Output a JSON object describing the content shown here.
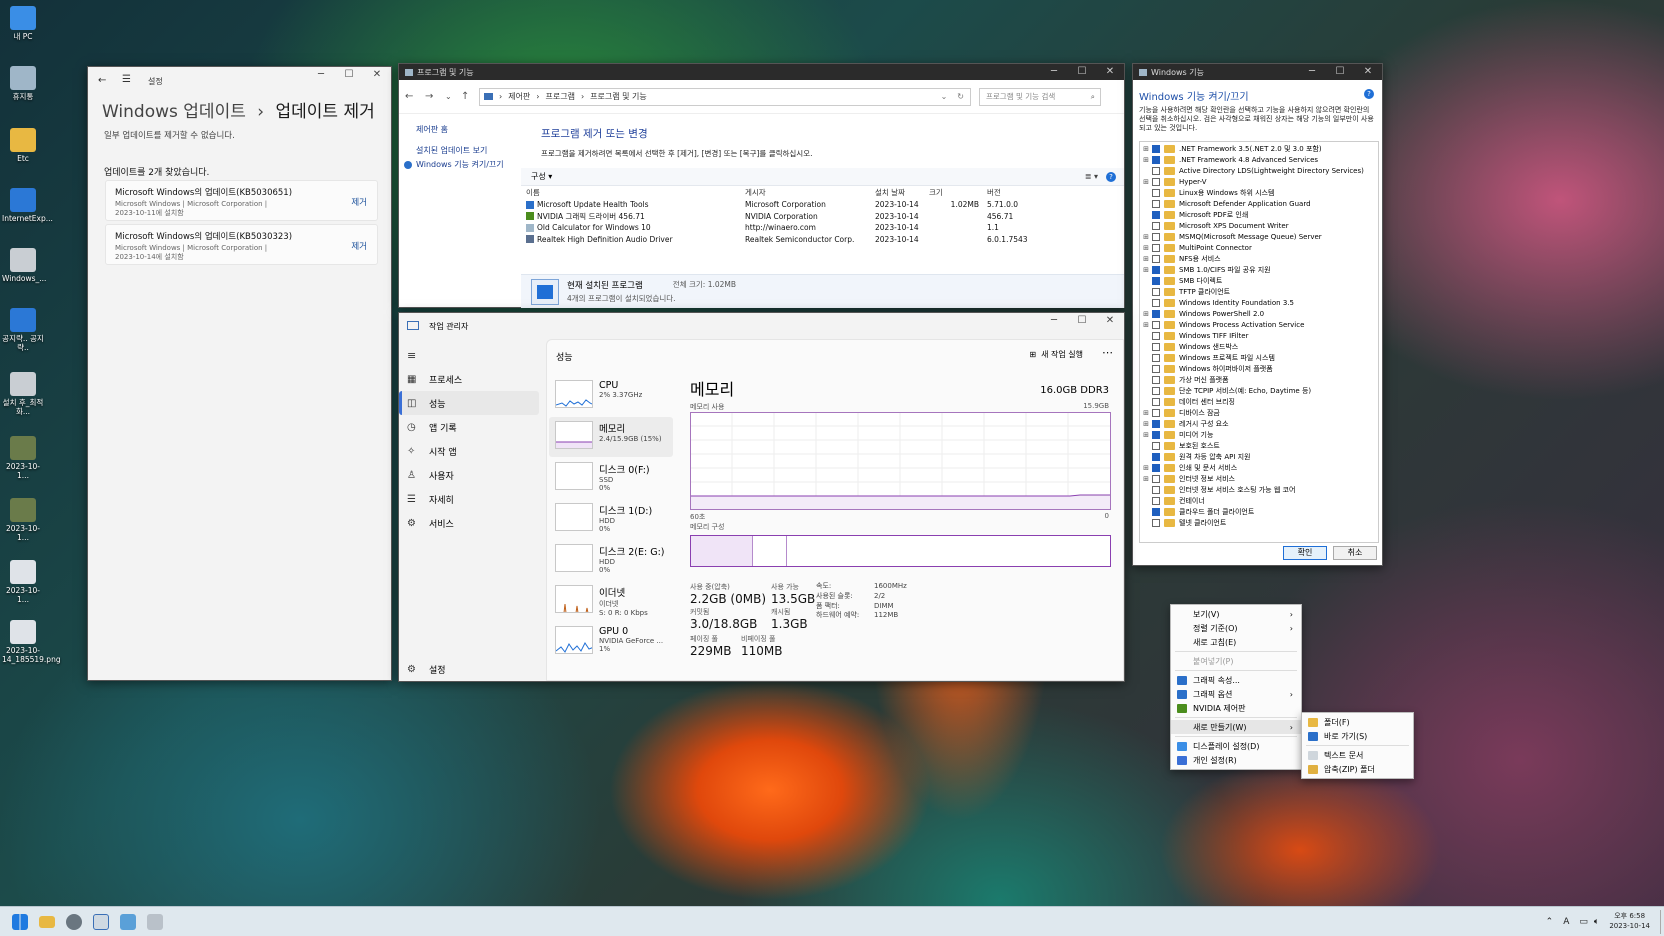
{
  "desktop_icons": [
    {
      "label": "내 PC",
      "color": "#3a8ee6"
    },
    {
      "label": "휴지통",
      "color": "#9fb6c8"
    },
    {
      "label": "Etc",
      "color": "#e8b842"
    },
    {
      "label": "InternetExp...",
      "color": "#2b78d6"
    },
    {
      "label": "Windows_...",
      "color": "#c9ced3"
    },
    {
      "label": "공지략.. 공지략..",
      "color": "#2b78d6"
    },
    {
      "label": "설치 후_최적화...",
      "color": "#c9ced3"
    },
    {
      "label": "2023-10-1...",
      "color": "#6a7b4a"
    },
    {
      "label": "2023-10-1...",
      "color": "#6a7b4a"
    },
    {
      "label": "2023-10-1...",
      "color": "#dfe3e8"
    },
    {
      "label": "2023-10-14_185519.png",
      "color": "#dfe3e8"
    }
  ],
  "settings": {
    "app_title": "설정",
    "breadcrumb_parent": "Windows 업데이트",
    "breadcrumb_sep": "›",
    "page_title": "업데이트 제거",
    "note": "일부 업데이트를 제거할 수 없습니다.",
    "found": "업데이트를 2개 찾았습니다.",
    "updates": [
      {
        "name": "Microsoft Windows의 업데이트(KB5030651)",
        "meta": "Microsoft Windows  |  Microsoft Corporation  |",
        "date": "2023-10-11에 설치함",
        "action": "제거"
      },
      {
        "name": "Microsoft Windows의 업데이트(KB5030323)",
        "meta": "Microsoft Windows  |  Microsoft Corporation  |",
        "date": "2023-10-14에 설치함",
        "action": "제거"
      }
    ]
  },
  "programs": {
    "title": "프로그램 및 기능",
    "address": [
      "제어판",
      "프로그램",
      "프로그램 및 기능"
    ],
    "search_placeholder": "프로그램 및 기능 검색",
    "left_links": {
      "home": "제어판 홈",
      "installed_updates": "설치된 업데이트 보기",
      "features": "Windows 기능 켜기/끄기"
    },
    "heading": "프로그램 제거 또는 변경",
    "desc": "프로그램을 제거하려면 목록에서 선택한 후 [제거], [변경] 또는 [복구]를 클릭하십시오.",
    "organize": "구성 ▾",
    "columns": [
      "이름",
      "게시자",
      "설치 날짜",
      "크기",
      "버전"
    ],
    "rows": [
      {
        "name": "Microsoft Update Health Tools",
        "publisher": "Microsoft Corporation",
        "date": "2023-10-14",
        "size": "1.02MB",
        "version": "5.71.0.0"
      },
      {
        "name": "NVIDIA 그래픽 드라이버 456.71",
        "publisher": "NVIDIA Corporation",
        "date": "2023-10-14",
        "size": "",
        "version": "456.71"
      },
      {
        "name": "Old Calculator for Windows 10",
        "publisher": "http://winaero.com",
        "date": "2023-10-14",
        "size": "",
        "version": "1.1"
      },
      {
        "name": "Realtek High Definition Audio Driver",
        "publisher": "Realtek Semiconductor Corp.",
        "date": "2023-10-14",
        "size": "",
        "version": "6.0.1.7543"
      }
    ],
    "footer_title": "현재 설치된 프로그램",
    "footer_total": "전체 크기:  1.02MB",
    "footer_count": "4개의 프로그램이 설치되었습니다."
  },
  "features": {
    "title": "Windows 기능",
    "heading": "Windows 기능 켜기/끄기",
    "desc": "기능을 사용하려면 해당 확인란을 선택하고 기능을 사용하지 않으려면 확인란의 선택을 취소하십시오. 검은 사각형으로 채워진 상자는 해당 기능의 일부만이 사용되고 있는 것입니다.",
    "items": [
      {
        "label": ".NET Framework 3.5(.NET 2.0 및 3.0 포함)",
        "exp": true,
        "state": "on"
      },
      {
        "label": ".NET Framework 4.8 Advanced Services",
        "exp": true,
        "state": "on"
      },
      {
        "label": "Active Directory LDS(Lightweight Directory Services)",
        "exp": false,
        "state": "off"
      },
      {
        "label": "Hyper-V",
        "exp": true,
        "state": "off"
      },
      {
        "label": "Linux용 Windows 하위 시스템",
        "exp": false,
        "state": "off"
      },
      {
        "label": "Microsoft Defender Application Guard",
        "exp": false,
        "state": "off"
      },
      {
        "label": "Microsoft PDF로 인쇄",
        "exp": false,
        "state": "on"
      },
      {
        "label": "Microsoft XPS Document Writer",
        "exp": false,
        "state": "off"
      },
      {
        "label": "MSMQ(Microsoft Message Queue) Server",
        "exp": true,
        "state": "off"
      },
      {
        "label": "MultiPoint Connector",
        "exp": true,
        "state": "off"
      },
      {
        "label": "NFS용 서비스",
        "exp": true,
        "state": "off"
      },
      {
        "label": "SMB 1.0/CIFS 파일 공유 지원",
        "exp": true,
        "state": "on"
      },
      {
        "label": "SMB 다이렉트",
        "exp": false,
        "state": "on"
      },
      {
        "label": "TFTP 클라이언트",
        "exp": false,
        "state": "off"
      },
      {
        "label": "Windows Identity Foundation 3.5",
        "exp": false,
        "state": "off"
      },
      {
        "label": "Windows PowerShell 2.0",
        "exp": true,
        "state": "on"
      },
      {
        "label": "Windows Process Activation Service",
        "exp": true,
        "state": "off"
      },
      {
        "label": "Windows TIFF IFilter",
        "exp": false,
        "state": "off"
      },
      {
        "label": "Windows 샌드박스",
        "exp": false,
        "state": "off"
      },
      {
        "label": "Windows 프로젝트 파일 시스템",
        "exp": false,
        "state": "off"
      },
      {
        "label": "Windows 하이퍼바이저 플랫폼",
        "exp": false,
        "state": "off"
      },
      {
        "label": "가상 머신 플랫폼",
        "exp": false,
        "state": "off"
      },
      {
        "label": "단순 TCPIP 서비스(예: Echo, Daytime 등)",
        "exp": false,
        "state": "off"
      },
      {
        "label": "데이터 센터 브리징",
        "exp": false,
        "state": "off"
      },
      {
        "label": "디바이스 잠금",
        "exp": true,
        "state": "off"
      },
      {
        "label": "레거시 구성 요소",
        "exp": true,
        "state": "on"
      },
      {
        "label": "미디어 기능",
        "exp": true,
        "state": "on"
      },
      {
        "label": "보호된 호스트",
        "exp": false,
        "state": "off"
      },
      {
        "label": "원격 차등 압축 API 지원",
        "exp": false,
        "state": "on"
      },
      {
        "label": "인쇄 및 문서 서비스",
        "exp": true,
        "state": "on"
      },
      {
        "label": "인터넷 정보 서비스",
        "exp": true,
        "state": "off"
      },
      {
        "label": "인터넷 정보 서비스 호스팅 가능 웹 코어",
        "exp": false,
        "state": "off"
      },
      {
        "label": "컨테이너",
        "exp": false,
        "state": "off"
      },
      {
        "label": "클라우드 폴더 클라이언트",
        "exp": false,
        "state": "on"
      },
      {
        "label": "텔넷 클라이언트",
        "exp": false,
        "state": "off"
      }
    ],
    "ok": "확인",
    "cancel": "취소"
  },
  "taskmgr": {
    "title": "작업 관리자",
    "nav": [
      {
        "label": "프로세스",
        "icon": "▦"
      },
      {
        "label": "성능",
        "icon": "◫"
      },
      {
        "label": "앱 기록",
        "icon": "◷"
      },
      {
        "label": "시작 앱",
        "icon": "✧"
      },
      {
        "label": "사용자",
        "icon": "♙"
      },
      {
        "label": "자세히",
        "icon": "☰"
      },
      {
        "label": "서비스",
        "icon": "⚙"
      }
    ],
    "settings_label": "설정",
    "header": "성능",
    "new_task": "새 작업 실행",
    "perf_list": [
      {
        "name": "CPU",
        "sub1": "2% 3.37GHz",
        "sub2": ""
      },
      {
        "name": "메모리",
        "sub1": "2.4/15.9GB (15%)",
        "sub2": ""
      },
      {
        "name": "디스크 0(F:)",
        "sub1": "SSD",
        "sub2": "0%"
      },
      {
        "name": "디스크 1(D:)",
        "sub1": "HDD",
        "sub2": "0%"
      },
      {
        "name": "디스크 2(E: G:)",
        "sub1": "HDD",
        "sub2": "0%"
      },
      {
        "name": "이더넷",
        "sub1": "이더넷",
        "sub2": "S: 0 R: 0 Kbps"
      },
      {
        "name": "GPU 0",
        "sub1": "NVIDIA GeForce ...",
        "sub2": "1%"
      }
    ],
    "mem_title": "메모리",
    "mem_total": "16.0GB DDR3",
    "usage_label": "메모리 사용",
    "usage_max": "15.9GB",
    "graph_left": "60초",
    "graph_right": "0",
    "composition_label": "메모리 구성",
    "stats": {
      "in_use_l": "사용 중(압축)",
      "in_use_v": "2.2GB (0MB)",
      "avail_l": "사용 가능",
      "avail_v": "13.5GB",
      "committed_l": "커밋됨",
      "committed_v": "3.0/18.8GB",
      "cached_l": "캐시됨",
      "cached_v": "1.3GB",
      "paged_l": "페이징 풀",
      "paged_v": "229MB",
      "nonpaged_l": "비페이징 풀",
      "nonpaged_v": "110MB"
    },
    "details": [
      {
        "k": "속도:",
        "v": "1600MHz"
      },
      {
        "k": "사용된 슬롯:",
        "v": "2/2"
      },
      {
        "k": "폼 팩터:",
        "v": "DIMM"
      },
      {
        "k": "하드웨어 예약:",
        "v": "112MB"
      }
    ]
  },
  "context_menu": {
    "items": [
      {
        "label": "보기(V)",
        "arrow": true,
        "icon": ""
      },
      {
        "label": "정렬 기준(O)",
        "arrow": true,
        "icon": ""
      },
      {
        "label": "새로 고침(E)",
        "arrow": false,
        "icon": ""
      },
      {
        "sep": true
      },
      {
        "label": "붙여넣기(P)",
        "arrow": false,
        "icon": "",
        "disabled": true
      },
      {
        "sep": true
      },
      {
        "label": "그래픽 속성...",
        "arrow": false,
        "icon": "#2a6fc9"
      },
      {
        "label": "그래픽 옵션",
        "arrow": true,
        "icon": "#2a6fc9"
      },
      {
        "label": "NVIDIA 제어판",
        "arrow": false,
        "icon": "#4b8d1d"
      },
      {
        "sep": true
      },
      {
        "label": "새로 만들기(W)",
        "arrow": true,
        "icon": "",
        "hover": true
      },
      {
        "sep": true
      },
      {
        "label": "디스플레이 설정(D)",
        "arrow": false,
        "icon": "#3a8ee6"
      },
      {
        "label": "개인 설정(R)",
        "arrow": false,
        "icon": "#3a6fd6"
      }
    ],
    "submenu": [
      {
        "label": "폴더(F)",
        "icon": "#e8b842"
      },
      {
        "label": "바로 가기(S)",
        "icon": "#2a6fc9"
      },
      {
        "sep": true
      },
      {
        "label": "텍스트 문서",
        "icon": "#cfd6dc"
      },
      {
        "label": "압축(ZIP) 폴더",
        "icon": "#e0b040"
      }
    ]
  },
  "taskbar": {
    "time": "오후 6:58",
    "date": "2023-10-14",
    "ime": "A"
  }
}
